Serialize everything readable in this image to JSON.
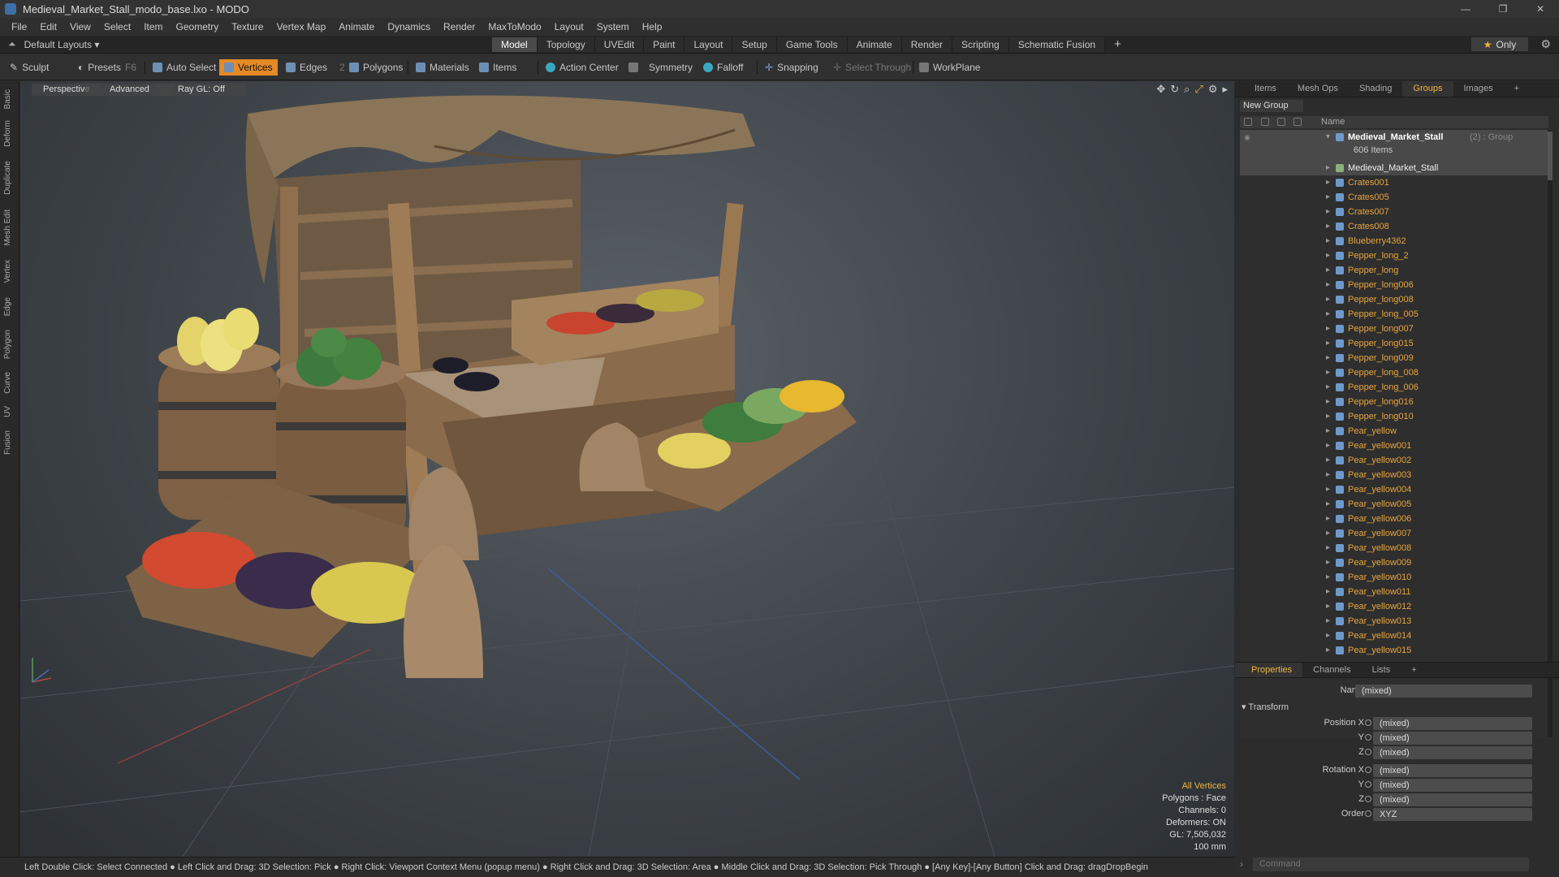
{
  "window": {
    "title": "Medieval_Market_Stall_modo_base.lxo - MODO"
  },
  "menu": [
    "File",
    "Edit",
    "View",
    "Select",
    "Item",
    "Geometry",
    "Texture",
    "Vertex Map",
    "Animate",
    "Dynamics",
    "Render",
    "MaxToModo",
    "Layout",
    "System",
    "Help"
  ],
  "layout": {
    "default": "Default Layouts ▾",
    "tabs": [
      "Model",
      "Topology",
      "UVEdit",
      "Paint",
      "Layout",
      "Setup",
      "Game Tools",
      "Animate",
      "Render",
      "Scripting",
      "Schematic Fusion"
    ],
    "active_tab": "Model",
    "only": "Only"
  },
  "toolbar": {
    "sculpt": "Sculpt",
    "presets": "Presets",
    "presets_key": "F6",
    "auto_select": "Auto Select",
    "vertices": "Vertices",
    "edges": "Edges",
    "edges_count": "2",
    "polygons": "Polygons",
    "materials": "Materials",
    "items": "Items",
    "action_center": "Action Center",
    "symmetry": "Symmetry",
    "falloff": "Falloff",
    "snapping": "Snapping",
    "select_through": "Select Through",
    "workplane": "WorkPlane"
  },
  "leftstrip": [
    "Basic",
    "Deform",
    "Duplicate",
    "Mesh Edit",
    "Vertex",
    "Edge",
    "Polygon",
    "Curve",
    "UV",
    "Fusion"
  ],
  "viewport": {
    "view": "Perspective",
    "advanced": "Advanced",
    "raygl": "Ray GL: Off",
    "hud": {
      "mode": "All Vertices",
      "polygons": "Polygons : Face",
      "channels": "Channels: 0",
      "deformers": "Deformers: ON",
      "gl": "GL: 7,505,032",
      "unit": "100 mm"
    }
  },
  "status": "Left Double Click: Select Connected ● Left Click and Drag: 3D Selection: Pick ● Right Click: Viewport Context Menu (popup menu) ● Right Click and Drag: 3D Selection: Area ● Middle Click and Drag: 3D Selection: Pick Through ● [Any Key]-[Any Button] Click and Drag: dragDropBegin",
  "panel": {
    "tabs": [
      "Items",
      "Mesh Ops",
      "Shading",
      "Groups",
      "Images"
    ],
    "active_tab": "Groups",
    "new_group": "New Group",
    "name_header": "Name",
    "group": {
      "name": "Medieval_Market_Stall",
      "suffix": "(2) : Group",
      "count": "606 Items"
    },
    "root_item": "Medieval_Market_Stall",
    "items": [
      "Crates001",
      "Crates005",
      "Crates007",
      "Crates008",
      "Blueberry4362",
      "Pepper_long_2",
      "Pepper_long",
      "Pepper_long006",
      "Pepper_long008",
      "Pepper_long_005",
      "Pepper_long007",
      "Pepper_long015",
      "Pepper_long009",
      "Pepper_long_008",
      "Pepper_long_006",
      "Pepper_long016",
      "Pepper_long010",
      "Pear_yellow",
      "Pear_yellow001",
      "Pear_yellow002",
      "Pear_yellow003",
      "Pear_yellow004",
      "Pear_yellow005",
      "Pear_yellow006",
      "Pear_yellow007",
      "Pear_yellow008",
      "Pear_yellow009",
      "Pear_yellow010",
      "Pear_yellow011",
      "Pear_yellow012",
      "Pear_yellow013",
      "Pear_yellow014",
      "Pear_yellow015"
    ]
  },
  "properties": {
    "tabs": [
      "Properties",
      "Channels",
      "Lists"
    ],
    "active_tab": "Properties",
    "name_label": "Name",
    "name_value": "(mixed)",
    "transform": "Transform",
    "rows": [
      {
        "label": "Position X",
        "value": "(mixed)"
      },
      {
        "label": "Y",
        "value": "(mixed)"
      },
      {
        "label": "Z",
        "value": "(mixed)"
      },
      {
        "label": "Rotation X",
        "value": "(mixed)"
      },
      {
        "label": "Y",
        "value": "(mixed)"
      },
      {
        "label": "Z",
        "value": "(mixed)"
      },
      {
        "label": "Order",
        "value": "XYZ"
      }
    ]
  },
  "command": {
    "placeholder": "Command"
  },
  "colors": {
    "accent": "#e48a26",
    "item_text": "#e8a53c"
  }
}
